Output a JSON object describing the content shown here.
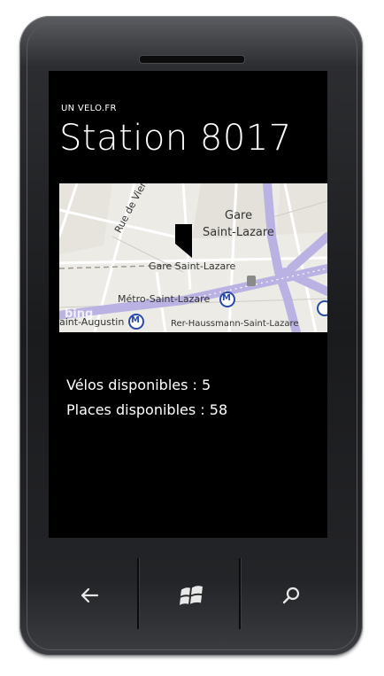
{
  "app": {
    "name": "UN VELO.FR"
  },
  "page": {
    "title": "Station 8017"
  },
  "map": {
    "labels": {
      "gare": "Gare",
      "gare2": "Saint-Lazare",
      "rue": "Rue de Vienne",
      "gare_saint_lazare": "Gare Saint-Lazare",
      "metro": "Métro-Saint-Lazare",
      "augustin": "aint-Augustin",
      "rer": "Rer-Haussmann-Saint-Lazare",
      "bing": "bing"
    },
    "metro_symbol": "M"
  },
  "info": {
    "velos": "Vélos disponibles : 5",
    "places": "Places disponibles : 58"
  },
  "hardware": {
    "back_icon": "back-arrow-icon",
    "start_icon": "windows-logo-icon",
    "search_icon": "search-icon"
  }
}
